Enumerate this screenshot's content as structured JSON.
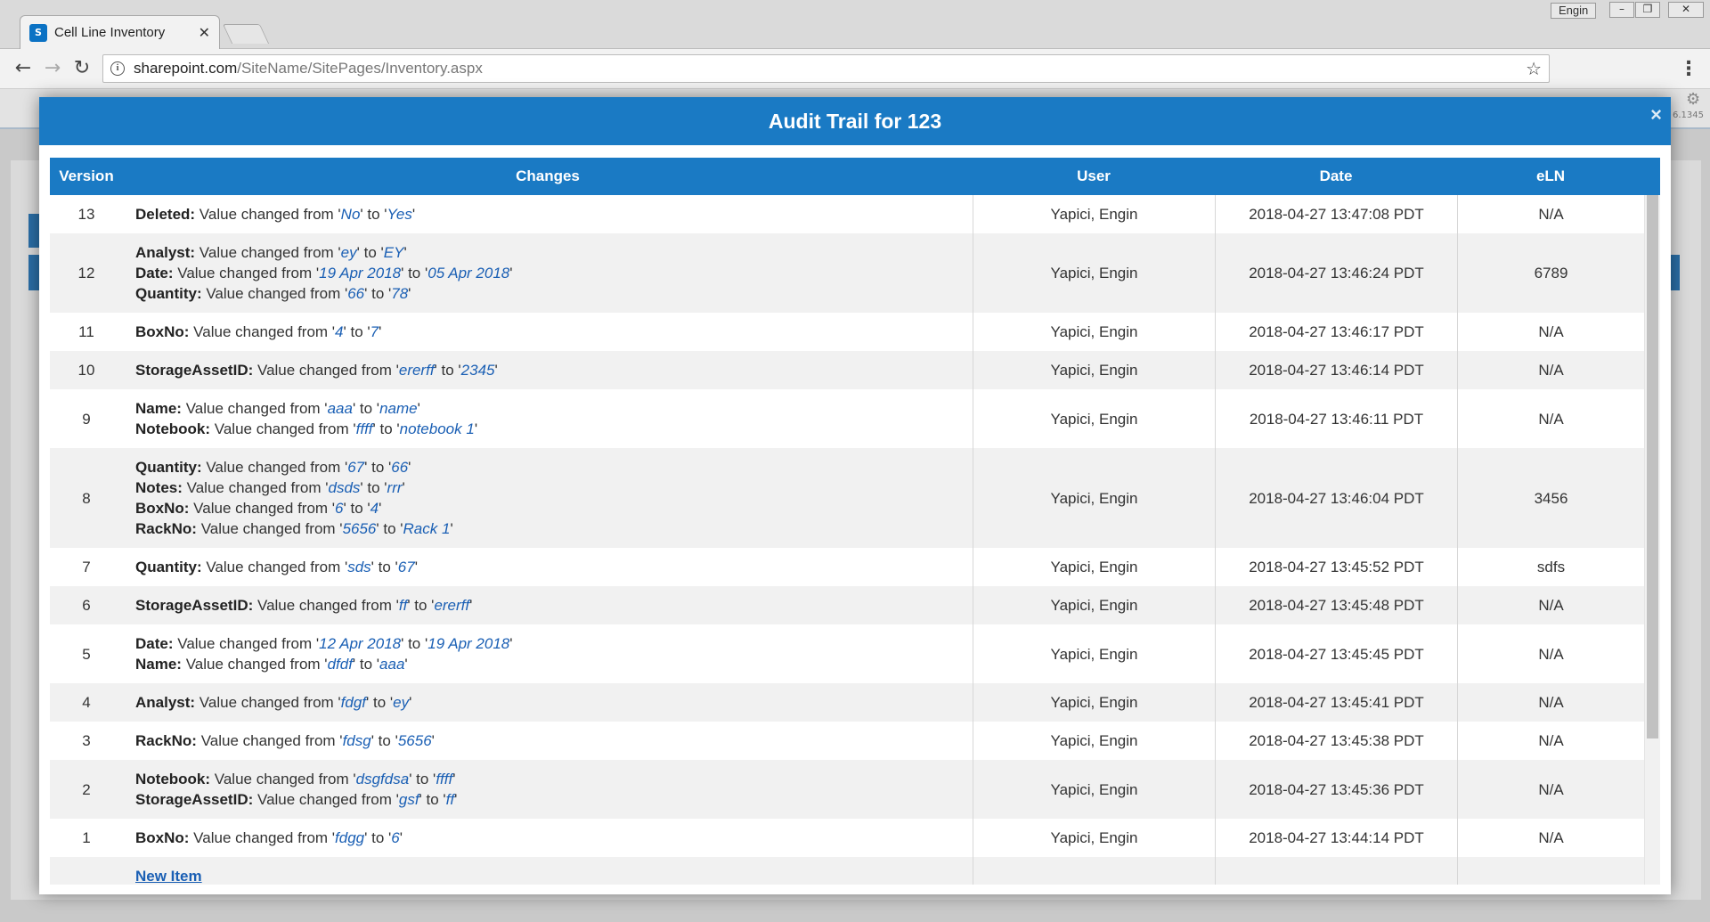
{
  "browser": {
    "tab_title": "Cell Line Inventory",
    "tab_favicon": "S",
    "window_user": "Engin",
    "url_host": "sharepoint.com",
    "url_path": "/SiteName/SitePages/Inventory.aspx"
  },
  "page": {
    "version_text": "6.1345"
  },
  "modal": {
    "title": "Audit Trail for 123",
    "close_glyph": "×"
  },
  "table": {
    "columns": [
      "Version",
      "Changes",
      "User",
      "Date",
      "eLN"
    ],
    "rows": [
      {
        "version": "13",
        "changes": [
          {
            "field": "Deleted:",
            "from": "No",
            "to": "Yes"
          }
        ],
        "user": "Yapici, Engin",
        "date": "2018-04-27 13:47:08 PDT",
        "eln": "N/A"
      },
      {
        "version": "12",
        "changes": [
          {
            "field": "Analyst:",
            "from": "ey",
            "to": "EY"
          },
          {
            "field": "Date:",
            "from": "19 Apr 2018",
            "to": "05 Apr 2018"
          },
          {
            "field": "Quantity:",
            "from": "66",
            "to": "78"
          }
        ],
        "user": "Yapici, Engin",
        "date": "2018-04-27 13:46:24 PDT",
        "eln": "6789"
      },
      {
        "version": "11",
        "changes": [
          {
            "field": "BoxNo:",
            "from": "4",
            "to": "7"
          }
        ],
        "user": "Yapici, Engin",
        "date": "2018-04-27 13:46:17 PDT",
        "eln": "N/A"
      },
      {
        "version": "10",
        "changes": [
          {
            "field": "StorageAssetID:",
            "from": "ererff",
            "to": "2345"
          }
        ],
        "user": "Yapici, Engin",
        "date": "2018-04-27 13:46:14 PDT",
        "eln": "N/A"
      },
      {
        "version": "9",
        "changes": [
          {
            "field": "Name:",
            "from": "aaa",
            "to": "name"
          },
          {
            "field": "Notebook:",
            "from": "ffff",
            "to": "notebook 1"
          }
        ],
        "user": "Yapici, Engin",
        "date": "2018-04-27 13:46:11 PDT",
        "eln": "N/A"
      },
      {
        "version": "8",
        "changes": [
          {
            "field": "Quantity:",
            "from": "67",
            "to": "66"
          },
          {
            "field": "Notes:",
            "from": "dsds",
            "to": "rrr"
          },
          {
            "field": "BoxNo:",
            "from": "6",
            "to": "4"
          },
          {
            "field": "RackNo:",
            "from": "5656",
            "to": "Rack 1"
          }
        ],
        "user": "Yapici, Engin",
        "date": "2018-04-27 13:46:04 PDT",
        "eln": "3456"
      },
      {
        "version": "7",
        "changes": [
          {
            "field": "Quantity:",
            "from": "sds",
            "to": "67"
          }
        ],
        "user": "Yapici, Engin",
        "date": "2018-04-27 13:45:52 PDT",
        "eln": "sdfs"
      },
      {
        "version": "6",
        "changes": [
          {
            "field": "StorageAssetID:",
            "from": "ff",
            "to": "ererff"
          }
        ],
        "user": "Yapici, Engin",
        "date": "2018-04-27 13:45:48 PDT",
        "eln": "N/A"
      },
      {
        "version": "5",
        "changes": [
          {
            "field": "Date:",
            "from": "12 Apr 2018",
            "to": "19 Apr 2018"
          },
          {
            "field": "Name:",
            "from": "dfdf",
            "to": "aaa"
          }
        ],
        "user": "Yapici, Engin",
        "date": "2018-04-27 13:45:45 PDT",
        "eln": "N/A"
      },
      {
        "version": "4",
        "changes": [
          {
            "field": "Analyst:",
            "from": "fdgf",
            "to": "ey"
          }
        ],
        "user": "Yapici, Engin",
        "date": "2018-04-27 13:45:41 PDT",
        "eln": "N/A"
      },
      {
        "version": "3",
        "changes": [
          {
            "field": "RackNo:",
            "from": "fdsg",
            "to": "5656"
          }
        ],
        "user": "Yapici, Engin",
        "date": "2018-04-27 13:45:38 PDT",
        "eln": "N/A"
      },
      {
        "version": "2",
        "changes": [
          {
            "field": "Notebook:",
            "from": "dsgfdsa",
            "to": "ffff"
          },
          {
            "field": "StorageAssetID:",
            "from": "gsf",
            "to": "ff"
          }
        ],
        "user": "Yapici, Engin",
        "date": "2018-04-27 13:45:36 PDT",
        "eln": "N/A"
      },
      {
        "version": "1",
        "changes": [
          {
            "field": "BoxNo:",
            "from": "fdgg",
            "to": "6"
          }
        ],
        "user": "Yapici, Engin",
        "date": "2018-04-27 13:44:14 PDT",
        "eln": "N/A"
      }
    ],
    "new_item_label": "New Item",
    "change_words": {
      "middle": "Value changed from",
      "to": "to"
    }
  }
}
